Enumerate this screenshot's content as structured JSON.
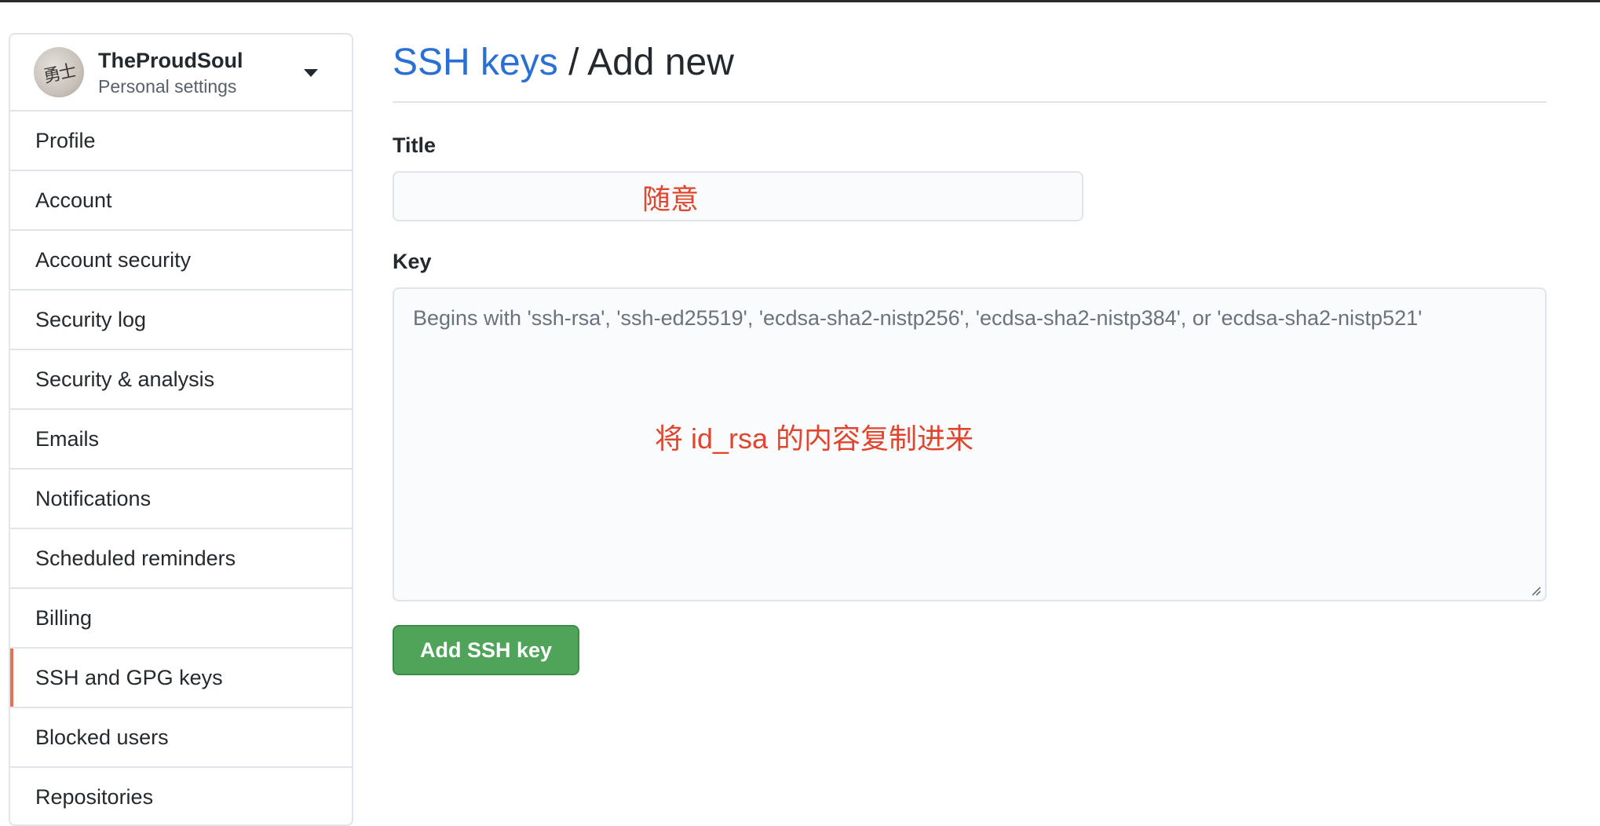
{
  "sidebar": {
    "user": {
      "name": "TheProudSoul",
      "subtitle": "Personal settings"
    },
    "items": [
      {
        "label": "Profile"
      },
      {
        "label": "Account"
      },
      {
        "label": "Account security"
      },
      {
        "label": "Security log"
      },
      {
        "label": "Security & analysis"
      },
      {
        "label": "Emails"
      },
      {
        "label": "Notifications"
      },
      {
        "label": "Scheduled reminders"
      },
      {
        "label": "Billing"
      },
      {
        "label": "SSH and GPG keys",
        "selected": true
      },
      {
        "label": "Blocked users"
      },
      {
        "label": "Repositories"
      }
    ],
    "selected_accent": "#e8705a"
  },
  "main": {
    "breadcrumb": {
      "link": "SSH keys",
      "separator": " / ",
      "current": "Add new"
    },
    "title_field": {
      "label": "Title",
      "value": "",
      "annotation": "随意"
    },
    "key_field": {
      "label": "Key",
      "placeholder": "Begins with 'ssh-rsa', 'ssh-ed25519', 'ecdsa-sha2-nistp256', 'ecdsa-sha2-nistp384', or 'ecdsa-sha2-nistp521'",
      "annotation": "将 id_rsa 的内容复制进来"
    },
    "submit_label": "Add SSH key"
  },
  "colors": {
    "link": "#2a6fd3",
    "primary_button": "#4fa45a",
    "annotation": "#e0452e"
  }
}
